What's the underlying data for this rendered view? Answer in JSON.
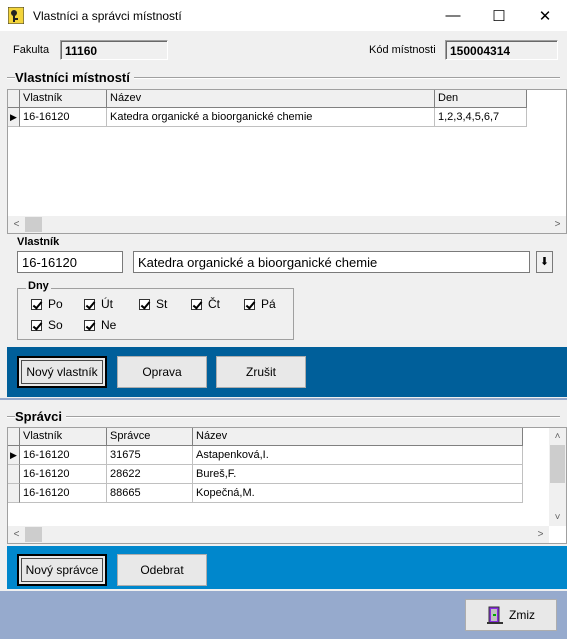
{
  "window": {
    "title": "Vlastníci a správci místností",
    "minimize_glyph": "—",
    "maximize_glyph": "☐",
    "close_glyph": "✕"
  },
  "header": {
    "faculty_label": "Fakulta",
    "faculty_value": "11160",
    "room_code_label": "Kód místnosti",
    "room_code_value": "150004314"
  },
  "owners": {
    "section_title": "Vlastníci místností",
    "columns": [
      "Vlastník",
      "Název",
      "Den"
    ],
    "rows": [
      {
        "owner": "16-16120",
        "name": "Katedra organické a bioorganické chemie",
        "days": "1,2,3,4,5,6,7"
      }
    ],
    "edit": {
      "label": "Vlastník",
      "owner_code": "16-16120",
      "owner_name": "Katedra organické a bioorganické chemie"
    },
    "days_group": {
      "label": "Dny",
      "days": [
        {
          "label": "Po",
          "checked": true
        },
        {
          "label": "Út",
          "checked": true
        },
        {
          "label": "St",
          "checked": true
        },
        {
          "label": "Čt",
          "checked": true
        },
        {
          "label": "Pá",
          "checked": true
        },
        {
          "label": "So",
          "checked": true
        },
        {
          "label": "Ne",
          "checked": true
        }
      ]
    },
    "buttons": {
      "new_owner": "Nový vlastník",
      "edit": "Oprava",
      "cancel": "Zrušit"
    },
    "toolbar_color": "#005f9a"
  },
  "managers": {
    "section_title": "Správci",
    "columns": [
      "Vlastník",
      "Správce",
      "Název"
    ],
    "rows": [
      {
        "owner": "16-16120",
        "manager": "31675",
        "name": "Astapenková,I."
      },
      {
        "owner": "16-16120",
        "manager": "28622",
        "name": "Bureš,F."
      },
      {
        "owner": "16-16120",
        "manager": "88665",
        "name": "Kopečná,M."
      }
    ],
    "buttons": {
      "new_manager": "Nový správce",
      "remove": "Odebrat"
    },
    "toolbar_color": "#0087cc"
  },
  "footer": {
    "close_button": "Zmiz",
    "background_color": "#96aacd"
  }
}
